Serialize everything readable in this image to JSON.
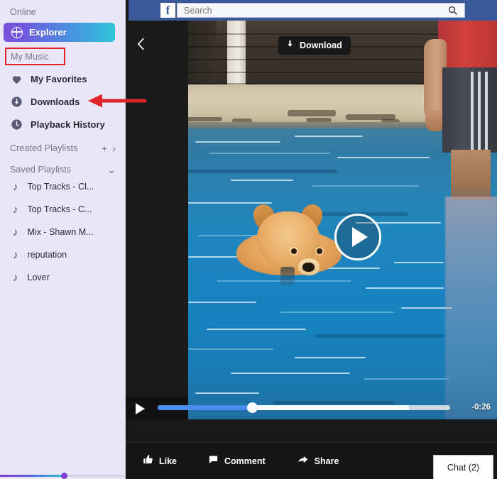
{
  "sidebar": {
    "online_label": "Online",
    "explorer": {
      "label": "Explorer",
      "icon": "globe-icon"
    },
    "my_music_label": "My Music",
    "my_music_highlight_color": "#e1232b",
    "items": [
      {
        "label": "My Favorites",
        "icon": "heart-icon"
      },
      {
        "label": "Downloads",
        "icon": "download-circle-icon"
      },
      {
        "label": "Playback History",
        "icon": "clock-icon"
      }
    ],
    "created_playlists": {
      "label": "Created Playlists",
      "add_icon": "plus-icon",
      "expand_icon": "chevron-right-icon"
    },
    "saved_playlists": {
      "label": "Saved Playlists",
      "expand_icon": "chevron-down-icon"
    },
    "playlists": [
      {
        "label": "Top Tracks - Cl...",
        "icon": "music-note-icon"
      },
      {
        "label": "Top Tracks - C...",
        "icon": "music-note-icon"
      },
      {
        "label": "Mix - Shawn M...",
        "icon": "music-note-icon"
      },
      {
        "label": "reputation",
        "icon": "music-note-icon"
      },
      {
        "label": "Lover",
        "icon": "music-note-icon"
      }
    ],
    "mini_player": {
      "progress_percent": 52,
      "gradient_from": "#7d3fd1",
      "gradient_to": "#2dc7d4"
    }
  },
  "facebook_bar": {
    "logo_glyph": "f",
    "brand_color": "#3b5998",
    "search": {
      "placeholder": "Search",
      "value": "",
      "icon": "search-icon"
    }
  },
  "player": {
    "back_icon": "chevron-left-icon",
    "download_tooltip": {
      "label": "Download",
      "icon": "download-arrow-icon"
    },
    "play_overlay_icon": "play-circle-icon",
    "controls": {
      "play_icon": "play-icon",
      "time_remaining": "-0:26",
      "progress_percent": 33,
      "buffered_percent": 86
    },
    "actions": [
      {
        "label": "Like",
        "icon": "thumbs-up-icon"
      },
      {
        "label": "Comment",
        "icon": "comment-icon"
      },
      {
        "label": "Share",
        "icon": "share-arrow-icon"
      }
    ],
    "chat_tab": {
      "label": "Chat (2)"
    }
  },
  "annotation": {
    "arrow_color": "#e1232b",
    "arrow_points_to": "Downloads"
  }
}
